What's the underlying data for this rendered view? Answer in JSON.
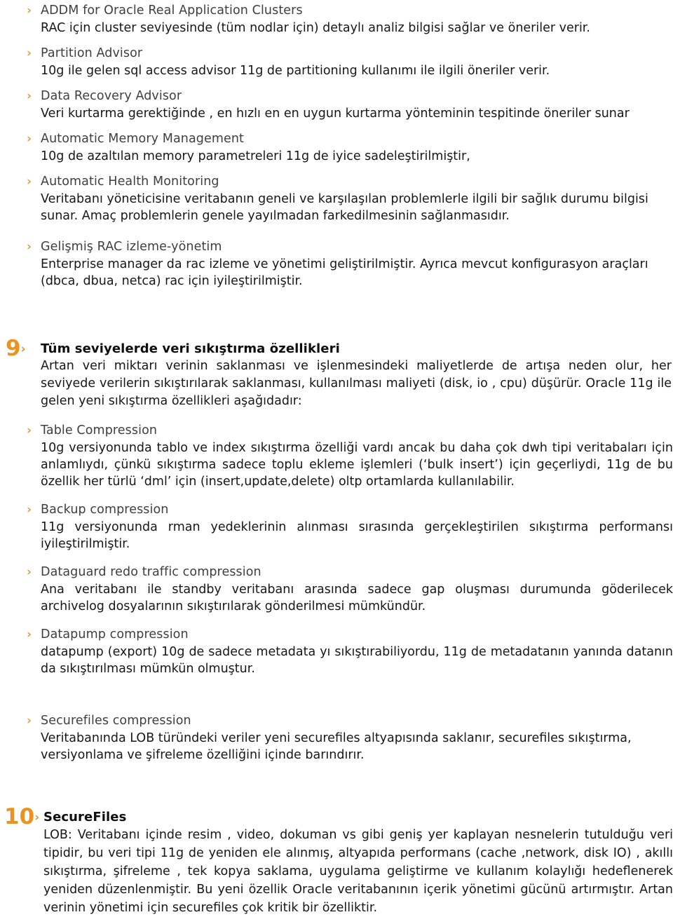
{
  "colors": {
    "bullet_chevron": "#e0a14a",
    "number_marker": "#ea9320",
    "heading_text": "#3f3f3f",
    "body_text": "#171717",
    "page_background": "#ffffff"
  },
  "icons": {
    "bullet": "chevron-right-icon",
    "bullet_glyph": "›"
  },
  "sections": [
    {
      "type": "sub",
      "heading": "ADDM for Oracle Real Application Clusters",
      "body": "RAC için cluster seviyesinde (tüm nodlar için) detaylı analiz bilgisi sağlar ve öneriler verir."
    },
    {
      "type": "sub",
      "heading": "Partition Advisor",
      "body": "10g ile gelen sql access advisor 11g de partitioning kullanımı ile ilgili öneriler verir."
    },
    {
      "type": "sub",
      "heading": "Data Recovery Advisor",
      "body": "Veri kurtarma gerektiğinde , en hızlı en en uygun kurtarma yönteminin tespitinde öneriler sunar"
    },
    {
      "type": "sub",
      "heading": "Automatic Memory Management",
      "body": "10g de azaltılan  memory parametreleri 11g de iyice sadeleştirilmiştir,"
    },
    {
      "type": "sub",
      "heading": "Automatic Health Monitoring",
      "body": "Veritabanı yöneticisine veritabanın geneli ve karşılaşılan problemlerle ilgili bir sağlık durumu bilgisi sunar. Amaç problemlerin genele  yayılmadan farkedilmesinin sağlanmasıdır."
    },
    {
      "type": "sub",
      "heading": "Gelişmiş RAC izleme-yönetim",
      "body": "Enterprise manager da rac izleme ve yönetimi geliştirilmiştir. Ayrıca mevcut konfigurasyon araçları (dbca, dbua, netca) rac için iyileştirilmiştir."
    },
    {
      "type": "numbered",
      "number": "9",
      "heading": "Tüm seviyelerde veri sıkıştırma özellikleri",
      "body": "Artan veri miktarı verinin saklanması ve işlenmesindeki  maliyetlerde de artışa neden olur, her seviyede verilerin sıkıştırılarak saklanması, kullanılması maliyeti (disk, io , cpu) düşürür. Oracle 11g ile gelen yeni sıkıştırma özellikleri aşağıdadır:",
      "children": [
        {
          "heading": "Table Compression",
          "body": "10g versiyonunda tablo ve index sıkıştırma özelliği vardı ancak bu daha çok dwh tipi veritabaları için anlamlıydı, çünkü sıkıştırma sadece  toplu ekleme işlemleri (‘bulk insert’) için geçerliydi, 11g de bu özellik her türlü ‘dml’ için (insert,update,delete) oltp ortamlarda kullanılabilir."
        },
        {
          "heading": "Backup compression",
          "body": "11g versiyonunda rman yedeklerinin alınması sırasında gerçekleştirilen sıkıştırma performansı iyileştirilmiştir."
        },
        {
          "heading": "Dataguard redo traffic compression",
          "body": "Ana veritabanı ile standby veritabanı arasında sadece gap oluşması durumunda göderilecek archivelog dosyalarının sıkıştırılarak gönderilmesi mümkündür."
        },
        {
          "heading": "Datapump compression",
          "body": "datapump (export) 10g de sadece metadata yı sıkıştırabiliyordu, 11g de metadatanın yanında datanın da sıkıştırılması mümkün olmuştur."
        },
        {
          "heading": "Securefiles compression",
          "body": "Veritabanında LOB türündeki veriler yeni securefiles altyapısında saklanır, securefiles sıkıştırma, versiyonlama ve şifreleme özelliğini içinde barındırır."
        }
      ]
    },
    {
      "type": "numbered",
      "number": "10",
      "heading": "SecureFiles",
      "body": "LOB: Veritabanı içinde  resim , video, dokuman vs gibi geniş yer kaplayan nesnelerin tutulduğu veri tipidir, bu veri tipi 11g de yeniden ele alınmış, altyapıda performans (cache ,network, disk IO) , akıllı sıkıştırma, şifreleme , tek kopya saklama,  uygulama geliştirme ve kullanım  kolaylığı  hedeflenerek yeniden düzenlenmiştir. Bu yeni özellik  Oracle veritabanının içerik yönetimi gücünü artırmıştır. Artan verinin yönetimi için securefiles çok kritik bir özelliktir.",
      "children": []
    }
  ]
}
